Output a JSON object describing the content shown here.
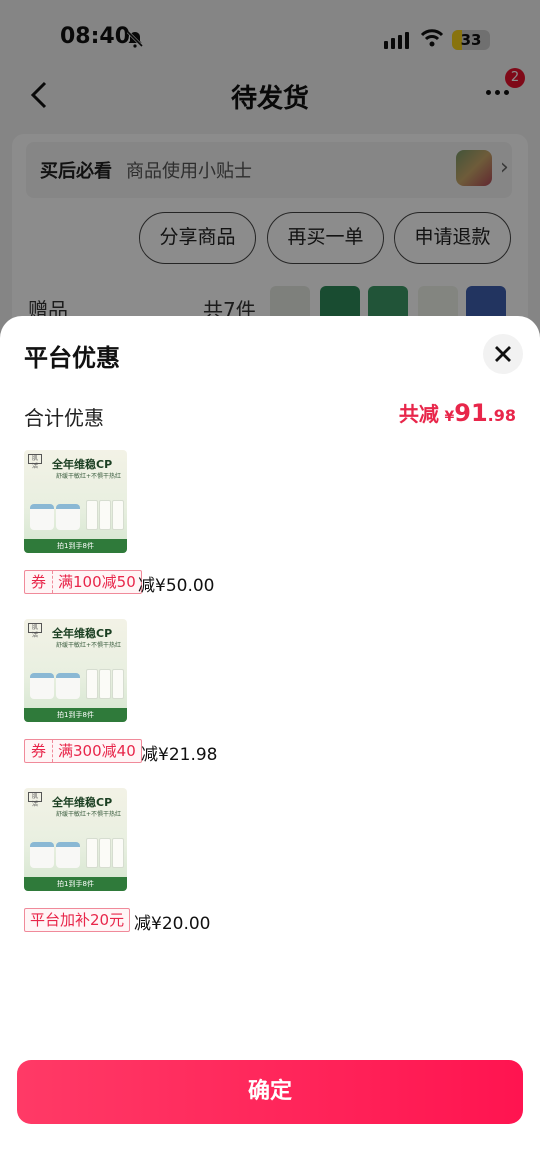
{
  "status_bar": {
    "time": "08:40",
    "battery": "33"
  },
  "nav": {
    "title": "待发货",
    "more_badge": "2"
  },
  "tips": {
    "strong": "买后必看",
    "text": "商品使用小贴士"
  },
  "actions": [
    "分享商品",
    "再买一单",
    "申请退款"
  ],
  "gifts": {
    "label": "赠品",
    "count": "共7件"
  },
  "sheet": {
    "title": "平台优惠",
    "total_label": "合计优惠",
    "total_prefix": "共减",
    "currency": "¥",
    "total_int": "91",
    "total_dec": ".98",
    "product_image": {
      "brand": "肌 活",
      "headline": "全年维稳CP",
      "subline": "舒缓干敏红+不惧干热红",
      "ribbon": "拍1到手8件"
    },
    "items": [
      {
        "tag": "券",
        "rule": "满100减50",
        "discount": "减¥50.00"
      },
      {
        "tag": "券",
        "rule": "满300减40",
        "discount": "减¥21.98"
      },
      {
        "tag": "",
        "rule": "平台加补20元",
        "discount": "减¥20.00"
      }
    ],
    "confirm": "确定"
  },
  "colors": {
    "accent": "#e8264a",
    "button_start": "#ff3a66",
    "button_end": "#ff1450"
  }
}
